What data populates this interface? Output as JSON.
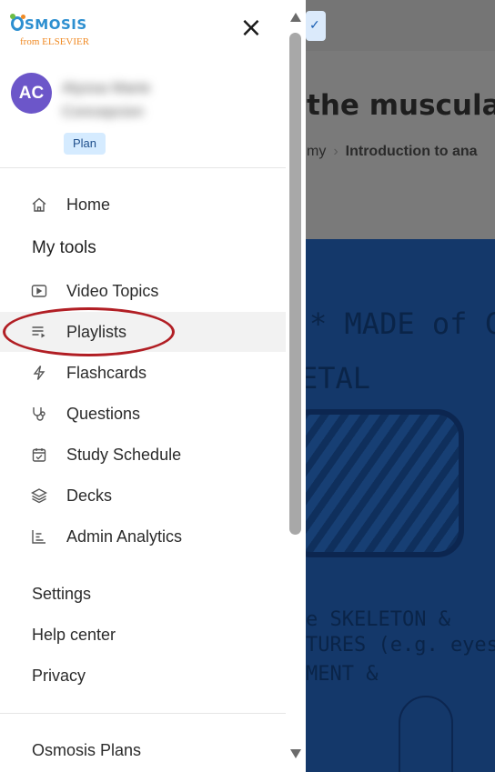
{
  "background": {
    "title": "the muscular",
    "breadcrumb_prev": "my",
    "breadcrumb_current": "Introduction to ana",
    "video_lines": [
      "* MADE of CO",
      "ETAL",
      "e SKELETON &",
      "TURES (e.g. eyes)",
      "MENT &"
    ]
  },
  "logo": {
    "brand": "SMOSIS",
    "sub": "from ELSEVIER"
  },
  "close_glyph": "×",
  "user": {
    "initials": "AC",
    "name_line1": "Alyssa Marie",
    "name_line2": "Concepcion",
    "plan": "Plan"
  },
  "nav": {
    "home": "Home",
    "my_tools": "My tools",
    "tools": [
      {
        "label": "Video Topics",
        "icon": "play-icon"
      },
      {
        "label": "Playlists",
        "icon": "playlist-icon"
      },
      {
        "label": "Flashcards",
        "icon": "lightning-icon"
      },
      {
        "label": "Questions",
        "icon": "stethoscope-icon"
      },
      {
        "label": "Study Schedule",
        "icon": "calendar-check-icon"
      },
      {
        "label": "Decks",
        "icon": "layers-icon"
      },
      {
        "label": "Admin Analytics",
        "icon": "chart-icon"
      }
    ],
    "settings": "Settings",
    "help_center": "Help center",
    "privacy": "Privacy",
    "osmosis_plans": "Osmosis Plans"
  },
  "colors": {
    "avatar": "#6c56c9",
    "plan_badge": "#d5ebff",
    "highlight_ring": "#b11e24",
    "overlay_video": "#14386a"
  }
}
